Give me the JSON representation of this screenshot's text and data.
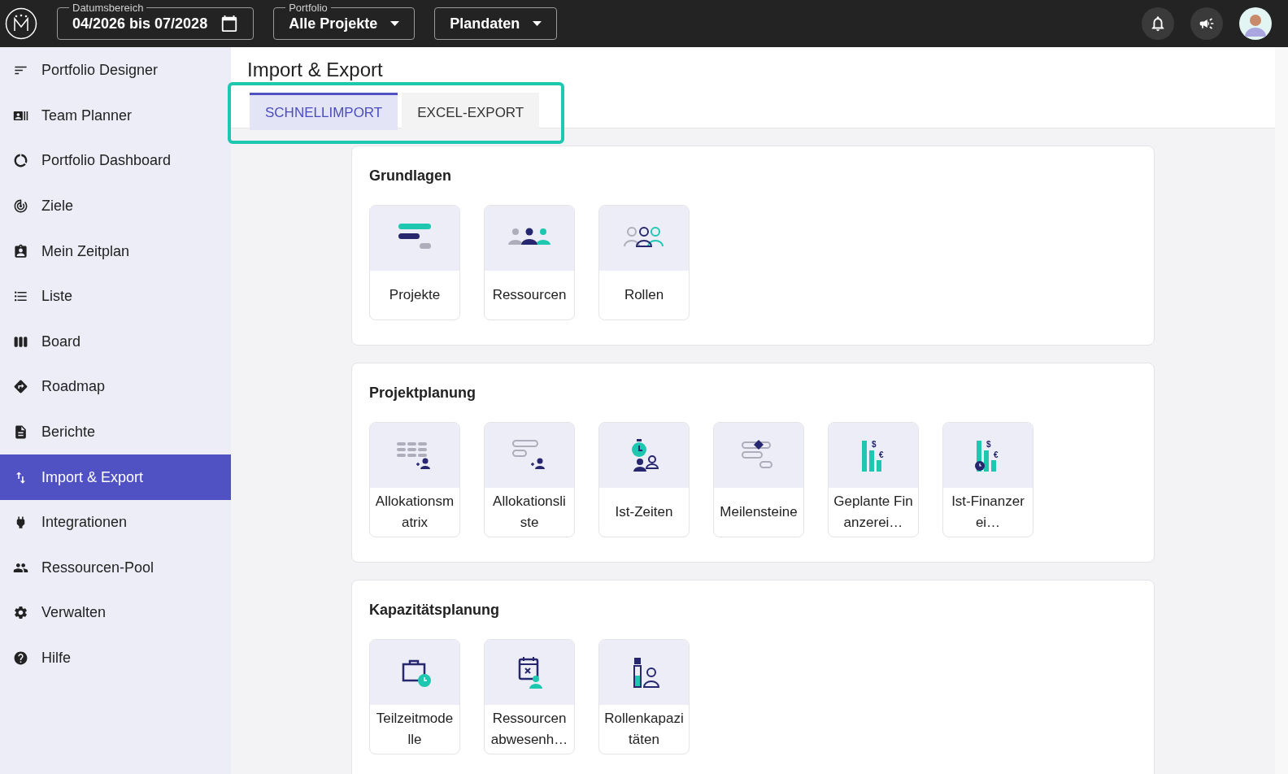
{
  "topbar": {
    "filters": [
      {
        "kind": "date",
        "label": "Datumsbereich",
        "value": "04/2026 bis 07/2028"
      },
      {
        "kind": "select",
        "label": "Portfolio",
        "value": "Alle Projekte"
      },
      {
        "kind": "select",
        "value": "Plandaten"
      }
    ]
  },
  "sidebar": {
    "items": [
      {
        "label": "Portfolio Designer",
        "selected": false
      },
      {
        "label": "Team Planner",
        "selected": false
      },
      {
        "label": "Portfolio Dashboard",
        "selected": false
      },
      {
        "label": "Ziele",
        "selected": false
      },
      {
        "label": "Mein Zeitplan",
        "selected": false
      },
      {
        "label": "Liste",
        "selected": false
      },
      {
        "label": "Board",
        "selected": false
      },
      {
        "label": "Roadmap",
        "selected": false
      },
      {
        "label": "Berichte",
        "selected": false
      },
      {
        "label": "Import & Export",
        "selected": true
      },
      {
        "label": "Integrationen",
        "selected": false
      },
      {
        "label": "Ressourcen-Pool",
        "selected": false
      },
      {
        "label": "Verwalten",
        "selected": false
      },
      {
        "label": "Hilfe",
        "selected": false
      }
    ]
  },
  "page": {
    "title": "Import & Export",
    "tabs": [
      {
        "label": "SCHNELLIMPORT",
        "selected": true
      },
      {
        "label": "EXCEL-EXPORT",
        "selected": false
      }
    ],
    "sections": [
      {
        "title": "Grundlagen",
        "tiles": [
          {
            "label": "Projekte",
            "kind": "projects"
          },
          {
            "label": "Ressourcen",
            "kind": "resources"
          },
          {
            "label": "Rollen",
            "kind": "roles"
          }
        ]
      },
      {
        "title": "Projektplanung",
        "tiles": [
          {
            "label": "Allokationsmatrix",
            "kind": "matrix"
          },
          {
            "label": "Allokationsliste",
            "kind": "list"
          },
          {
            "label": "Ist-Zeiten",
            "kind": "time"
          },
          {
            "label": "Meilensteine",
            "kind": "milestones"
          },
          {
            "label": "Geplante Finanzerei…",
            "kind": "finance",
            "symbols": [
              "$",
              "€"
            ]
          },
          {
            "label": "Ist-Finanzerei…",
            "kind": "actualfinance",
            "symbols": [
              "$",
              "€"
            ]
          }
        ]
      },
      {
        "title": "Kapazitätsplanung",
        "tiles": [
          {
            "label": "Teilzeitmodelle",
            "kind": "parttime"
          },
          {
            "label": "Ressourcen abwesenh…",
            "kind": "absence"
          },
          {
            "label": "Rollenkapazitäten",
            "kind": "rolecap"
          }
        ]
      }
    ]
  }
}
